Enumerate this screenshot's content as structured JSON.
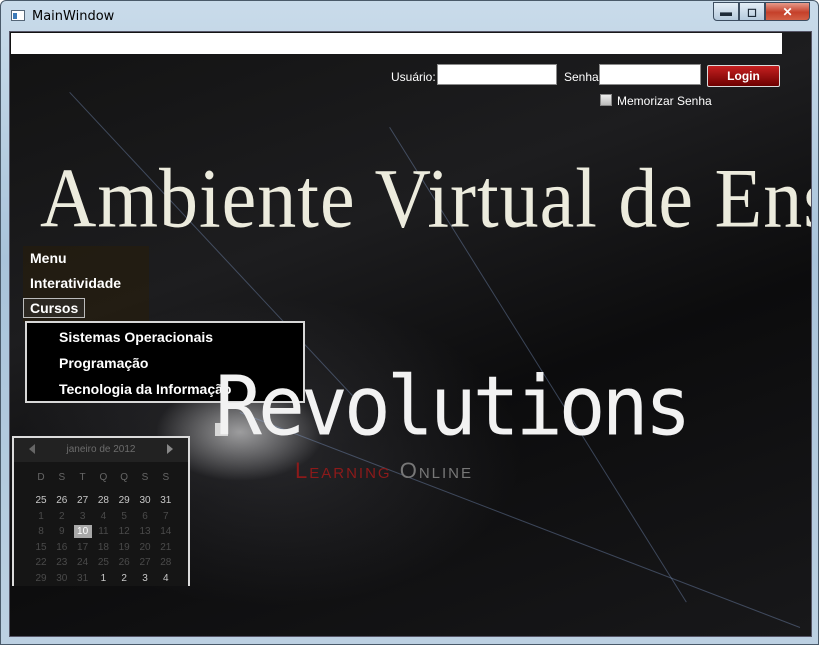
{
  "window": {
    "title": "MainWindow",
    "minimize": "▬",
    "maximize": "◻",
    "close": "✕"
  },
  "login": {
    "user_label": "Usuário:",
    "pass_label": "Senha:",
    "user_value": "",
    "pass_value": "",
    "button": "Login",
    "remember": "Memorizar Senha"
  },
  "banner": {
    "title": "Ambiente Virtual de Ensino"
  },
  "menu": {
    "items": [
      "Menu",
      "Interatividade",
      "Cursos"
    ],
    "submenu": [
      "Sistemas Operacionais",
      "Programação",
      "Tecnologia da Informação"
    ]
  },
  "logo": {
    "word": "Revolutions",
    "tag1": "Learning",
    "tag2": "Online"
  },
  "calendar": {
    "title": "janeiro de 2012",
    "days_of_week": [
      "D",
      "S",
      "T",
      "Q",
      "Q",
      "S",
      "S"
    ],
    "weeks": [
      [
        "25",
        "26",
        "27",
        "28",
        "29",
        "30",
        "31"
      ],
      [
        "1",
        "2",
        "3",
        "4",
        "5",
        "6",
        "7"
      ],
      [
        "8",
        "9",
        "10",
        "11",
        "12",
        "13",
        "14"
      ],
      [
        "15",
        "16",
        "17",
        "18",
        "19",
        "20",
        "21"
      ],
      [
        "22",
        "23",
        "24",
        "25",
        "26",
        "27",
        "28"
      ],
      [
        "29",
        "30",
        "31",
        "1",
        "2",
        "3",
        "4"
      ]
    ],
    "today": "10"
  },
  "colors": {
    "accent": "#b01515",
    "background": "#050505"
  }
}
